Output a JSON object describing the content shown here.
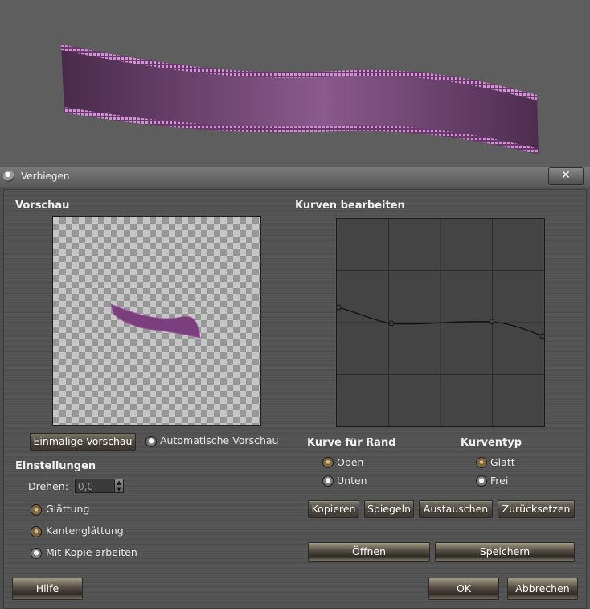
{
  "dialog": {
    "title": "Verbiegen",
    "close_label": "✕"
  },
  "preview": {
    "heading": "Vorschau",
    "once_button": "Einmalige Vorschau",
    "auto_label": "Automatische Vorschau"
  },
  "curves": {
    "heading": "Kurven bearbeiten"
  },
  "curve_for_edge": {
    "heading": "Kurve  für Rand",
    "options": [
      "Oben",
      "Unten"
    ],
    "selected": "Unten"
  },
  "curve_type": {
    "heading": "Kurventyp",
    "options": [
      "Glatt",
      "Frei"
    ],
    "selected": "Frei"
  },
  "settings": {
    "heading": "Einstellungen",
    "rotate_label": "Drehen:",
    "rotate_value": "0,0",
    "smoothing_label": "Glättung",
    "antialias_label": "Kantenglättung",
    "copy_label": "Mit Kopie arbeiten"
  },
  "curve_buttons": {
    "copy": "Kopieren",
    "mirror": "Spiegeln",
    "swap": "Austauschen",
    "reset": "Zurücksetzen"
  },
  "file_buttons": {
    "open": "Öffnen",
    "save": "Speichern"
  },
  "footer": {
    "help": "Hilfe",
    "ok": "OK",
    "cancel": "Abbrechen"
  },
  "colors": {
    "ribbon": "#7a4a7c",
    "ribbon_edge": "#b47ab8"
  }
}
